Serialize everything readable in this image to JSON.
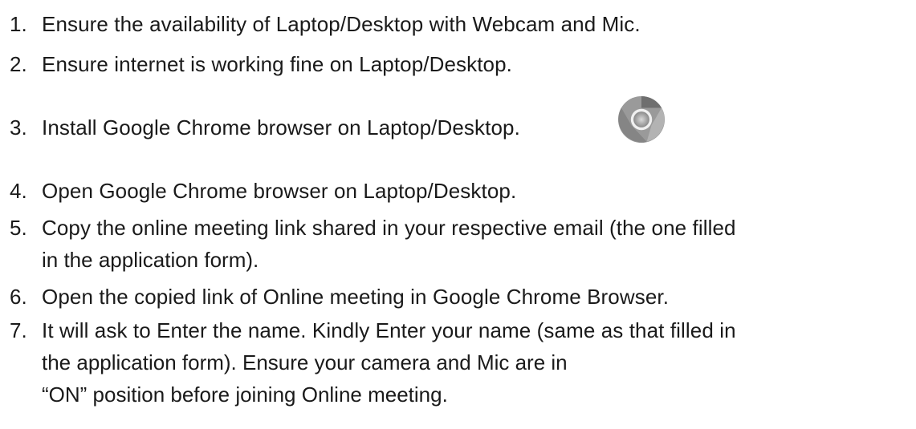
{
  "items": [
    {
      "num": "1.",
      "text": "Ensure the availability of Laptop/Desktop with Webcam and Mic."
    },
    {
      "num": "2.",
      "text": "Ensure internet is working fine on Laptop/Desktop."
    },
    {
      "num": "3.",
      "text": "Install Google Chrome browser on Laptop/Desktop."
    },
    {
      "num": "4.",
      "text": "Open Google Chrome browser on Laptop/Desktop."
    },
    {
      "num": "5.",
      "text": "Copy the online meeting link shared in your respective email (the one filled",
      "cont": [
        "in the application form)."
      ]
    },
    {
      "num": "6.",
      "text": "Open the copied link of Online meeting in Google Chrome Browser."
    },
    {
      "num": "7.",
      "text": "It will ask to Enter the name. Kindly Enter your name (same as that filled in",
      "cont": [
        "the application form). Ensure your camera and Mic are in",
        "“ON” position before joining Online meeting."
      ]
    }
  ],
  "icons": {
    "chrome": "chrome-logo-icon"
  }
}
